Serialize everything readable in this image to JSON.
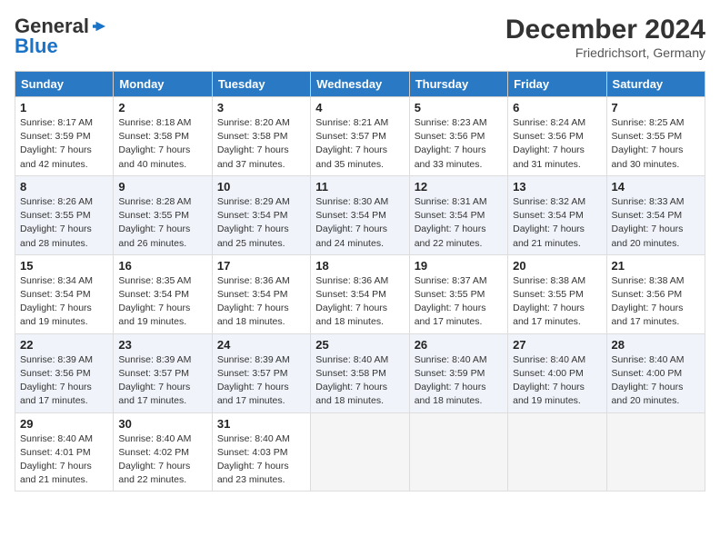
{
  "logo": {
    "general": "General",
    "blue": "Blue",
    "tagline": ""
  },
  "header": {
    "month": "December 2024",
    "location": "Friedrichsort, Germany"
  },
  "weekdays": [
    "Sunday",
    "Monday",
    "Tuesday",
    "Wednesday",
    "Thursday",
    "Friday",
    "Saturday"
  ],
  "weeks": [
    [
      {
        "day": "1",
        "info": "Sunrise: 8:17 AM\nSunset: 3:59 PM\nDaylight: 7 hours\nand 42 minutes."
      },
      {
        "day": "2",
        "info": "Sunrise: 8:18 AM\nSunset: 3:58 PM\nDaylight: 7 hours\nand 40 minutes."
      },
      {
        "day": "3",
        "info": "Sunrise: 8:20 AM\nSunset: 3:58 PM\nDaylight: 7 hours\nand 37 minutes."
      },
      {
        "day": "4",
        "info": "Sunrise: 8:21 AM\nSunset: 3:57 PM\nDaylight: 7 hours\nand 35 minutes."
      },
      {
        "day": "5",
        "info": "Sunrise: 8:23 AM\nSunset: 3:56 PM\nDaylight: 7 hours\nand 33 minutes."
      },
      {
        "day": "6",
        "info": "Sunrise: 8:24 AM\nSunset: 3:56 PM\nDaylight: 7 hours\nand 31 minutes."
      },
      {
        "day": "7",
        "info": "Sunrise: 8:25 AM\nSunset: 3:55 PM\nDaylight: 7 hours\nand 30 minutes."
      }
    ],
    [
      {
        "day": "8",
        "info": "Sunrise: 8:26 AM\nSunset: 3:55 PM\nDaylight: 7 hours\nand 28 minutes."
      },
      {
        "day": "9",
        "info": "Sunrise: 8:28 AM\nSunset: 3:55 PM\nDaylight: 7 hours\nand 26 minutes."
      },
      {
        "day": "10",
        "info": "Sunrise: 8:29 AM\nSunset: 3:54 PM\nDaylight: 7 hours\nand 25 minutes."
      },
      {
        "day": "11",
        "info": "Sunrise: 8:30 AM\nSunset: 3:54 PM\nDaylight: 7 hours\nand 24 minutes."
      },
      {
        "day": "12",
        "info": "Sunrise: 8:31 AM\nSunset: 3:54 PM\nDaylight: 7 hours\nand 22 minutes."
      },
      {
        "day": "13",
        "info": "Sunrise: 8:32 AM\nSunset: 3:54 PM\nDaylight: 7 hours\nand 21 minutes."
      },
      {
        "day": "14",
        "info": "Sunrise: 8:33 AM\nSunset: 3:54 PM\nDaylight: 7 hours\nand 20 minutes."
      }
    ],
    [
      {
        "day": "15",
        "info": "Sunrise: 8:34 AM\nSunset: 3:54 PM\nDaylight: 7 hours\nand 19 minutes."
      },
      {
        "day": "16",
        "info": "Sunrise: 8:35 AM\nSunset: 3:54 PM\nDaylight: 7 hours\nand 19 minutes."
      },
      {
        "day": "17",
        "info": "Sunrise: 8:36 AM\nSunset: 3:54 PM\nDaylight: 7 hours\nand 18 minutes."
      },
      {
        "day": "18",
        "info": "Sunrise: 8:36 AM\nSunset: 3:54 PM\nDaylight: 7 hours\nand 18 minutes."
      },
      {
        "day": "19",
        "info": "Sunrise: 8:37 AM\nSunset: 3:55 PM\nDaylight: 7 hours\nand 17 minutes."
      },
      {
        "day": "20",
        "info": "Sunrise: 8:38 AM\nSunset: 3:55 PM\nDaylight: 7 hours\nand 17 minutes."
      },
      {
        "day": "21",
        "info": "Sunrise: 8:38 AM\nSunset: 3:56 PM\nDaylight: 7 hours\nand 17 minutes."
      }
    ],
    [
      {
        "day": "22",
        "info": "Sunrise: 8:39 AM\nSunset: 3:56 PM\nDaylight: 7 hours\nand 17 minutes."
      },
      {
        "day": "23",
        "info": "Sunrise: 8:39 AM\nSunset: 3:57 PM\nDaylight: 7 hours\nand 17 minutes."
      },
      {
        "day": "24",
        "info": "Sunrise: 8:39 AM\nSunset: 3:57 PM\nDaylight: 7 hours\nand 17 minutes."
      },
      {
        "day": "25",
        "info": "Sunrise: 8:40 AM\nSunset: 3:58 PM\nDaylight: 7 hours\nand 18 minutes."
      },
      {
        "day": "26",
        "info": "Sunrise: 8:40 AM\nSunset: 3:59 PM\nDaylight: 7 hours\nand 18 minutes."
      },
      {
        "day": "27",
        "info": "Sunrise: 8:40 AM\nSunset: 4:00 PM\nDaylight: 7 hours\nand 19 minutes."
      },
      {
        "day": "28",
        "info": "Sunrise: 8:40 AM\nSunset: 4:00 PM\nDaylight: 7 hours\nand 20 minutes."
      }
    ],
    [
      {
        "day": "29",
        "info": "Sunrise: 8:40 AM\nSunset: 4:01 PM\nDaylight: 7 hours\nand 21 minutes."
      },
      {
        "day": "30",
        "info": "Sunrise: 8:40 AM\nSunset: 4:02 PM\nDaylight: 7 hours\nand 22 minutes."
      },
      {
        "day": "31",
        "info": "Sunrise: 8:40 AM\nSunset: 4:03 PM\nDaylight: 7 hours\nand 23 minutes."
      },
      null,
      null,
      null,
      null
    ]
  ]
}
